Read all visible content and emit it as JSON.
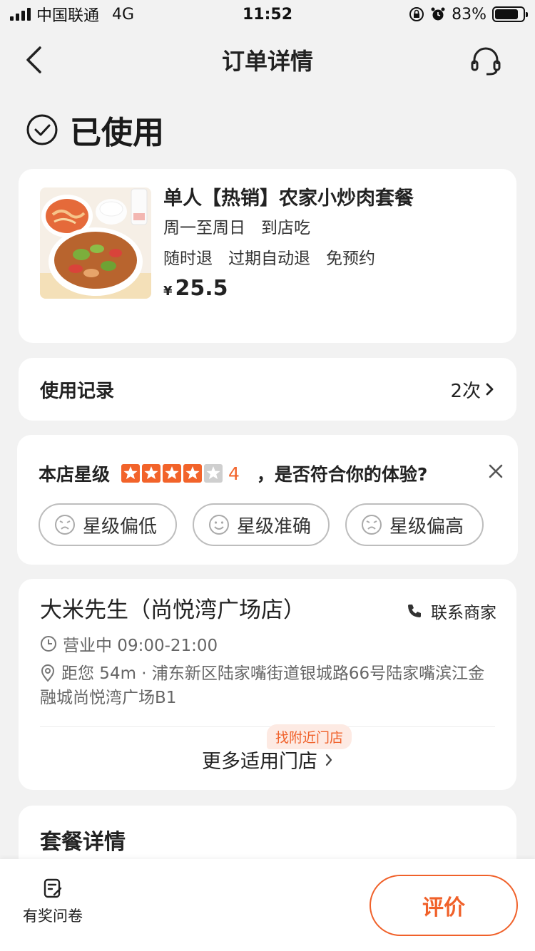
{
  "status_bar": {
    "carrier": "中国联通",
    "network": "4G",
    "time": "11:52",
    "battery": "83%",
    "battery_level": 0.83
  },
  "nav": {
    "title": "订单详情",
    "back_icon": "chevron-left-icon",
    "service_icon": "headset-icon"
  },
  "order": {
    "status": "已使用"
  },
  "product": {
    "name": "单人【热销】农家小炒肉套餐",
    "tags_line1": [
      "周一至周日",
      "到店吃"
    ],
    "tags_line2": [
      "随时退",
      "过期自动退",
      "免预约"
    ],
    "price_symbol": "¥",
    "price": "25.5"
  },
  "usage": {
    "label": "使用记录",
    "count": "2次"
  },
  "rating": {
    "label": "本店星级",
    "stars": 4,
    "max_stars": 5,
    "score": "4",
    "question": "，是否符合你的体验?",
    "options": [
      "星级偏低",
      "星级准确",
      "星级偏高"
    ],
    "star_color": "#f2632a"
  },
  "store": {
    "name": "大米先生（尚悦湾广场店）",
    "contact": "联系商家",
    "hours": "营业中 09:00-21:00",
    "address": "距您 54m · 浦东新区陆家嘴街道银城路66号陆家嘴滨江金融城尚悦湾广场B1",
    "nearby_badge": "找附近门店",
    "more_stores": "更多适用门店"
  },
  "package": {
    "title": "套餐详情"
  },
  "bottom": {
    "survey": "有奖问卷",
    "review": "评价"
  },
  "colors": {
    "accent": "#f0612a",
    "background": "#f2f2f2"
  }
}
